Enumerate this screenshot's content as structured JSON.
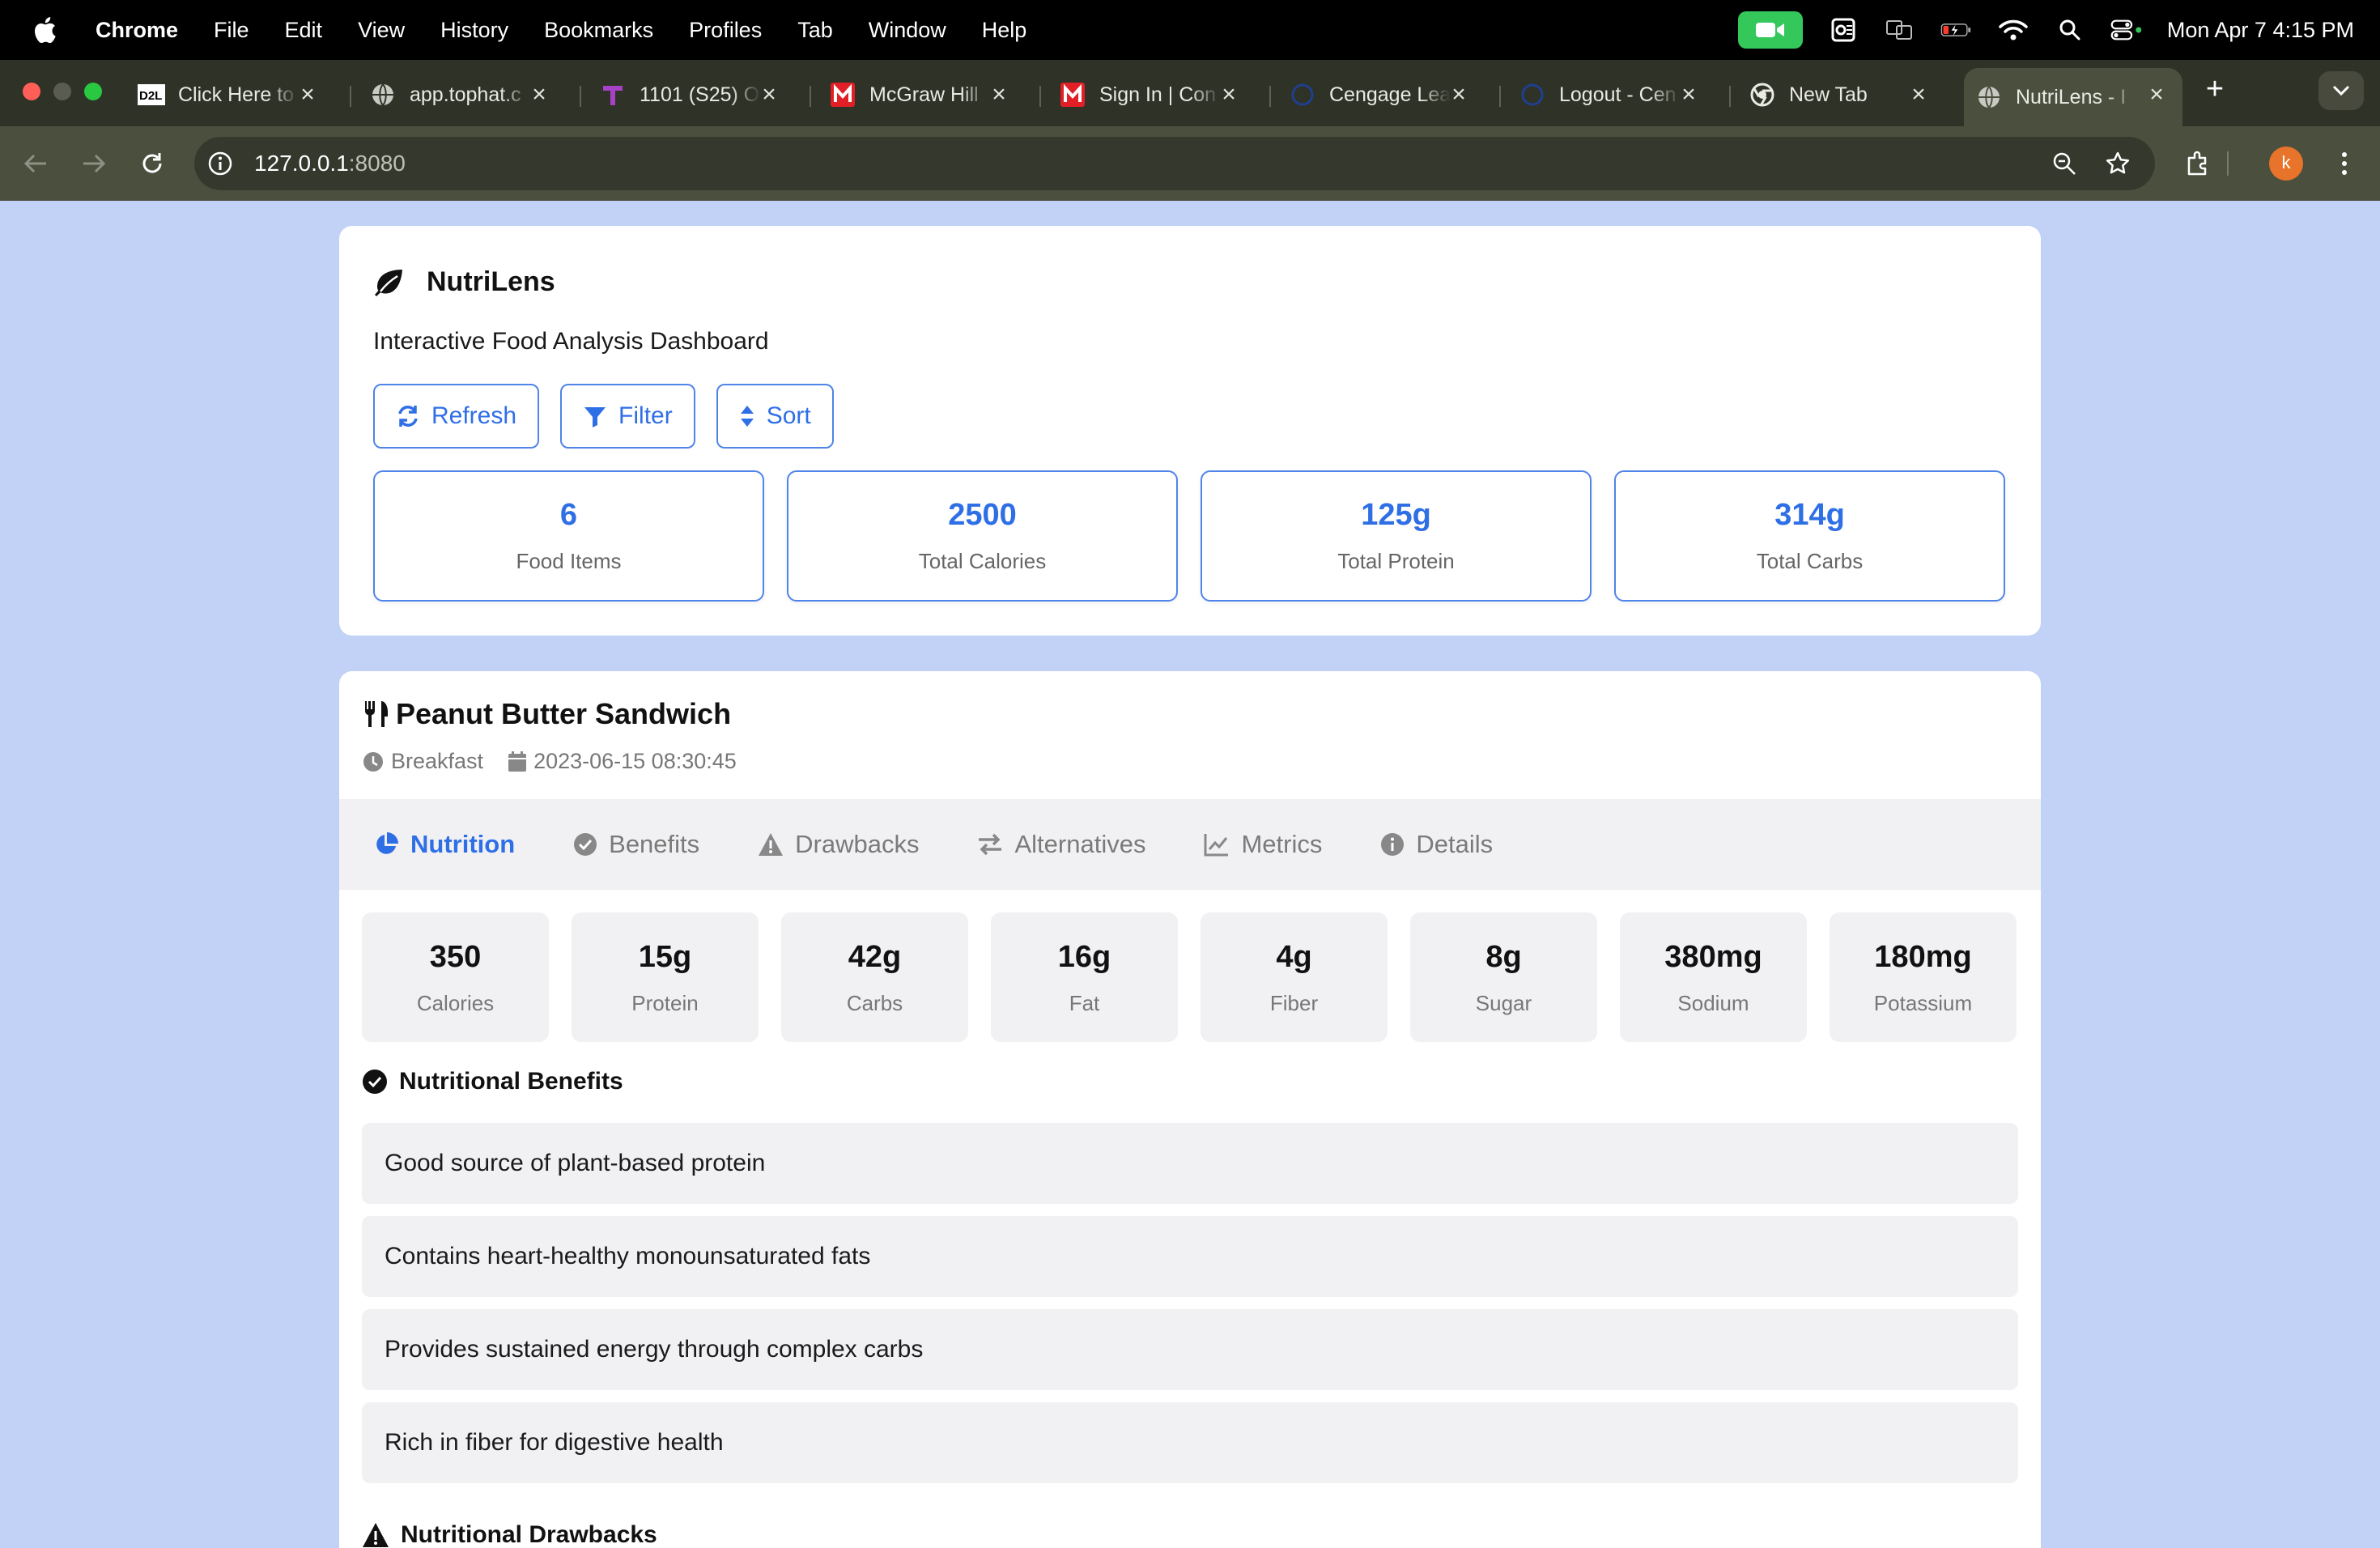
{
  "menubar": {
    "app": "Chrome",
    "items": [
      "File",
      "Edit",
      "View",
      "History",
      "Bookmarks",
      "Profiles",
      "Tab",
      "Window",
      "Help"
    ],
    "clock": "Mon Apr 7  4:15 PM"
  },
  "browser": {
    "tabs": [
      {
        "title": "Click Here to",
        "favicon": "d2l-icon"
      },
      {
        "title": "app.tophat.c",
        "favicon": "globe-icon"
      },
      {
        "title": "1101 (S25) O",
        "favicon": "tophat-icon"
      },
      {
        "title": "McGraw Hill",
        "favicon": "mcgraw-icon"
      },
      {
        "title": "Sign In | Con",
        "favicon": "mcgraw-icon"
      },
      {
        "title": "Cengage Lea",
        "favicon": "cengage-icon"
      },
      {
        "title": "Logout - Cen",
        "favicon": "cengage-icon"
      },
      {
        "title": "New Tab",
        "favicon": "chrome-icon"
      },
      {
        "title": "NutriLens - I",
        "favicon": "globe-icon"
      }
    ],
    "url_host": "127.0.0.1",
    "url_port": ":8080",
    "profile_initial": "k"
  },
  "app": {
    "name": "NutriLens",
    "subtitle": "Interactive Food Analysis Dashboard",
    "buttons": {
      "refresh": "Refresh",
      "filter": "Filter",
      "sort": "Sort"
    },
    "stats": [
      {
        "value": "6",
        "label": "Food Items"
      },
      {
        "value": "2500",
        "label": "Total Calories"
      },
      {
        "value": "125g",
        "label": "Total Protein"
      },
      {
        "value": "314g",
        "label": "Total Carbs"
      }
    ]
  },
  "food": {
    "name": "Peanut Butter Sandwich",
    "meal": "Breakfast",
    "timestamp": "2023-06-15 08:30:45",
    "tabs": [
      "Nutrition",
      "Benefits",
      "Drawbacks",
      "Alternatives",
      "Metrics",
      "Details"
    ],
    "active_tab": "Nutrition",
    "nutrients": [
      {
        "value": "350",
        "label": "Calories"
      },
      {
        "value": "15g",
        "label": "Protein"
      },
      {
        "value": "42g",
        "label": "Carbs"
      },
      {
        "value": "16g",
        "label": "Fat"
      },
      {
        "value": "4g",
        "label": "Fiber"
      },
      {
        "value": "8g",
        "label": "Sugar"
      },
      {
        "value": "380mg",
        "label": "Sodium"
      },
      {
        "value": "180mg",
        "label": "Potassium"
      }
    ],
    "benefits_heading": "Nutritional Benefits",
    "benefits": [
      "Good source of plant-based protein",
      "Contains heart-healthy monounsaturated fats",
      "Provides sustained energy through complex carbs",
      "Rich in fiber for digestive health"
    ],
    "drawbacks_heading": "Nutritional Drawbacks"
  },
  "colors": {
    "accent": "#2f6fe6",
    "page_bg": "#c1d2f6",
    "chrome_frame": "#4b4f3e"
  }
}
